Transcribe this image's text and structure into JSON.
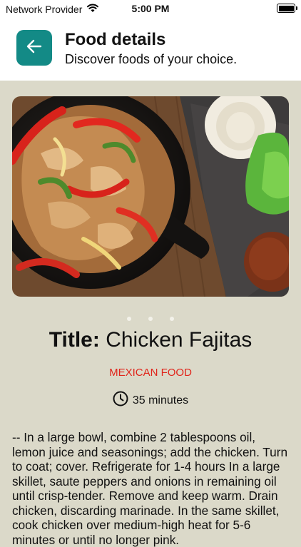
{
  "status_bar": {
    "carrier": "Network Provider",
    "time": "5:00 PM"
  },
  "header": {
    "title": "Food details",
    "subtitle": "Discover foods of your choice."
  },
  "carousel": {
    "image_alt": "Chicken fajitas in a cast iron skillet",
    "page_count": 3,
    "active_index": 0
  },
  "recipe": {
    "title_label": "Title:",
    "title": "Chicken Fajitas",
    "category": "MEXICAN FOOD",
    "duration": "35 minutes",
    "description": "-- In a large bowl, combine 2 tablespoons oil, lemon juice and seasonings; add the chicken. Turn to coat; cover. Refrigerate for 1-4 hours In a large skillet, saute peppers and onions in remaining oil until crisp-tender. Remove and keep warm. Drain chicken, discarding marinade. In the same skillet, cook chicken over medium-high heat for 5-6 minutes or until no longer pink."
  },
  "colors": {
    "accent": "#138a86",
    "background": "#dbd9c9",
    "category": "#e0251b"
  }
}
